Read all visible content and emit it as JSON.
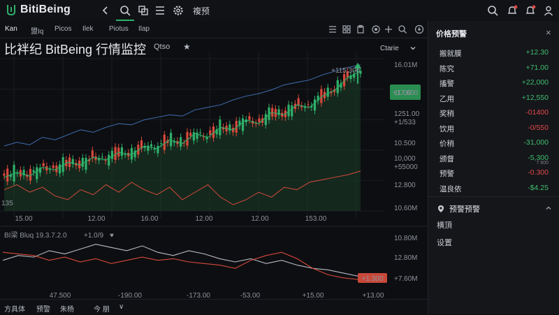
{
  "header": {
    "app_name": "BitiBeing",
    "nav_text": "複预",
    "icons": [
      "chevron-left-icon",
      "search-icon",
      "copy-icon",
      "list-icon",
      "gear-icon",
      "search-icon",
      "bell-icon",
      "bell-icon",
      "avatar-icon"
    ]
  },
  "subbar": {
    "tabs": [
      "Kan",
      "盟Iq",
      "Picos",
      "Ilek",
      "Piotus",
      "Ilap"
    ]
  },
  "title": {
    "text": "比袢纪 BitBeing 行情监控",
    "interval": "Qtso",
    "star": "★",
    "chart_type": "Ctarie"
  },
  "chart_data": {
    "type": "line",
    "x_tick_labels": [
      "15.00",
      "12.00",
      "16.00",
      "12.00",
      "12.00",
      "153.00"
    ],
    "y_tick_labels": [
      "16.01M",
      "11.00",
      "1251.00",
      "+1/533",
      "10.500",
      "10,000",
      "+55000",
      "12.800",
      "10.60M"
    ],
    "left_label": "135",
    "annotation_peak": "+115,300",
    "price_tag": "+17,600",
    "colors": {
      "up": "#2fb06a",
      "down": "#d84a3c",
      "line": "#3f6fb4",
      "area": "#1c4a2c"
    },
    "main_series": [
      {
        "name": "",
        "values": [
          30,
          34,
          31,
          38,
          36,
          42,
          40,
          46,
          44,
          50,
          48,
          55,
          53,
          60,
          57,
          65,
          62,
          70,
          68,
          76,
          73,
          82,
          80,
          88,
          86,
          95,
          100,
          110,
          115
        ]
      },
      {
        "name": "",
        "values": [
          55,
          58,
          56,
          62,
          60,
          64,
          68,
          66,
          70,
          73,
          72,
          76,
          78,
          80,
          79,
          84,
          86,
          88,
          92,
          95,
          97,
          100,
          104,
          106,
          108,
          112,
          115,
          118,
          120
        ]
      },
      {
        "name": "",
        "values": [
          20,
          24,
          18,
          22,
          15,
          12,
          20,
          16,
          24,
          18,
          26,
          20,
          16,
          22,
          12,
          18,
          24,
          14,
          8,
          12,
          18,
          14,
          22,
          20,
          26,
          28,
          30,
          32,
          35
        ]
      }
    ]
  },
  "indicator": {
    "label": "BI梁 Bluq 19.3.7.2.0",
    "value": "+1.0/9",
    "marker": "♥",
    "y_tick_labels": [
      "10.80M",
      "12.80M",
      "+7.60M"
    ],
    "x_tick_labels": [
      "47.500",
      "-190.00",
      "-173.00",
      "-53.00",
      "+15.00",
      "+13.00"
    ],
    "tag": "+1.300",
    "series": [
      {
        "name": "",
        "values": [
          40,
          46,
          44,
          52,
          48,
          54,
          60,
          56,
          52,
          58,
          50,
          46,
          52,
          48,
          42,
          38,
          42,
          36,
          40,
          34,
          30,
          28,
          24,
          20
        ]
      },
      {
        "name": "",
        "values": [
          50,
          48,
          46,
          40,
          44,
          38,
          42,
          36,
          40,
          44,
          40,
          42,
          38,
          36,
          34,
          30,
          40,
          46,
          50,
          42,
          30,
          22,
          18,
          16
        ]
      }
    ]
  },
  "bottombar": {
    "items": [
      "方具体",
      "预警",
      "朱杨",
      "今 朋",
      "∨"
    ]
  },
  "alerts_panel": {
    "title": "价格预警",
    "close_label": "×",
    "rows": [
      {
        "name": "搬就膜",
        "value": "+12.30",
        "tone": "pos",
        "sub": ""
      },
      {
        "name": "陈究",
        "value": "+71.00",
        "tone": "pos",
        "sub": ""
      },
      {
        "name": "搐警",
        "value": "+22,000",
        "tone": "pos",
        "sub": ""
      },
      {
        "name": "乙用",
        "value": "+12,550",
        "tone": "pos",
        "sub": ""
      },
      {
        "name": "奖稍",
        "value": "-01400",
        "tone": "neg",
        "sub": ""
      },
      {
        "name": "饮用",
        "value": "-0/550",
        "tone": "neg",
        "sub": ""
      },
      {
        "name": "价稍",
        "value": "-31,000",
        "tone": "pos",
        "sub": ""
      },
      {
        "name": "颁督",
        "value": "-5,300",
        "tone": "pos",
        "sub": "7 800"
      },
      {
        "name": "预警",
        "value": "-0.300",
        "tone": "neg",
        "sub": ""
      },
      {
        "name": "温良依",
        "value": "-$4.25",
        "tone": "pos",
        "sub": ""
      }
    ],
    "section_title": "预警预警",
    "links": [
      "横頂",
      "设置"
    ]
  }
}
